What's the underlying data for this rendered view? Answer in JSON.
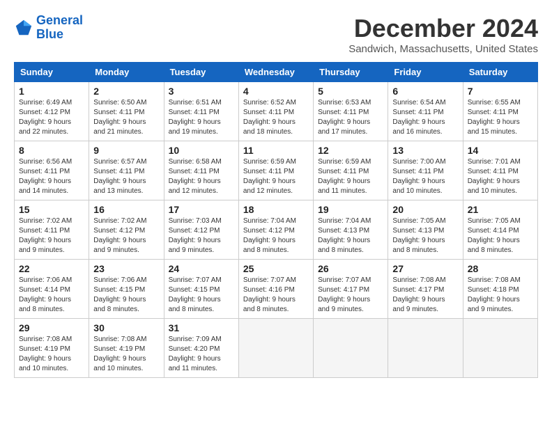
{
  "header": {
    "logo_line1": "General",
    "logo_line2": "Blue",
    "month_title": "December 2024",
    "location": "Sandwich, Massachusetts, United States"
  },
  "weekdays": [
    "Sunday",
    "Monday",
    "Tuesday",
    "Wednesday",
    "Thursday",
    "Friday",
    "Saturday"
  ],
  "weeks": [
    [
      {
        "day": "1",
        "info": "Sunrise: 6:49 AM\nSunset: 4:12 PM\nDaylight: 9 hours\nand 22 minutes."
      },
      {
        "day": "2",
        "info": "Sunrise: 6:50 AM\nSunset: 4:11 PM\nDaylight: 9 hours\nand 21 minutes."
      },
      {
        "day": "3",
        "info": "Sunrise: 6:51 AM\nSunset: 4:11 PM\nDaylight: 9 hours\nand 19 minutes."
      },
      {
        "day": "4",
        "info": "Sunrise: 6:52 AM\nSunset: 4:11 PM\nDaylight: 9 hours\nand 18 minutes."
      },
      {
        "day": "5",
        "info": "Sunrise: 6:53 AM\nSunset: 4:11 PM\nDaylight: 9 hours\nand 17 minutes."
      },
      {
        "day": "6",
        "info": "Sunrise: 6:54 AM\nSunset: 4:11 PM\nDaylight: 9 hours\nand 16 minutes."
      },
      {
        "day": "7",
        "info": "Sunrise: 6:55 AM\nSunset: 4:11 PM\nDaylight: 9 hours\nand 15 minutes."
      }
    ],
    [
      {
        "day": "8",
        "info": "Sunrise: 6:56 AM\nSunset: 4:11 PM\nDaylight: 9 hours\nand 14 minutes."
      },
      {
        "day": "9",
        "info": "Sunrise: 6:57 AM\nSunset: 4:11 PM\nDaylight: 9 hours\nand 13 minutes."
      },
      {
        "day": "10",
        "info": "Sunrise: 6:58 AM\nSunset: 4:11 PM\nDaylight: 9 hours\nand 12 minutes."
      },
      {
        "day": "11",
        "info": "Sunrise: 6:59 AM\nSunset: 4:11 PM\nDaylight: 9 hours\nand 12 minutes."
      },
      {
        "day": "12",
        "info": "Sunrise: 6:59 AM\nSunset: 4:11 PM\nDaylight: 9 hours\nand 11 minutes."
      },
      {
        "day": "13",
        "info": "Sunrise: 7:00 AM\nSunset: 4:11 PM\nDaylight: 9 hours\nand 10 minutes."
      },
      {
        "day": "14",
        "info": "Sunrise: 7:01 AM\nSunset: 4:11 PM\nDaylight: 9 hours\nand 10 minutes."
      }
    ],
    [
      {
        "day": "15",
        "info": "Sunrise: 7:02 AM\nSunset: 4:11 PM\nDaylight: 9 hours\nand 9 minutes."
      },
      {
        "day": "16",
        "info": "Sunrise: 7:02 AM\nSunset: 4:12 PM\nDaylight: 9 hours\nand 9 minutes."
      },
      {
        "day": "17",
        "info": "Sunrise: 7:03 AM\nSunset: 4:12 PM\nDaylight: 9 hours\nand 9 minutes."
      },
      {
        "day": "18",
        "info": "Sunrise: 7:04 AM\nSunset: 4:12 PM\nDaylight: 9 hours\nand 8 minutes."
      },
      {
        "day": "19",
        "info": "Sunrise: 7:04 AM\nSunset: 4:13 PM\nDaylight: 9 hours\nand 8 minutes."
      },
      {
        "day": "20",
        "info": "Sunrise: 7:05 AM\nSunset: 4:13 PM\nDaylight: 9 hours\nand 8 minutes."
      },
      {
        "day": "21",
        "info": "Sunrise: 7:05 AM\nSunset: 4:14 PM\nDaylight: 9 hours\nand 8 minutes."
      }
    ],
    [
      {
        "day": "22",
        "info": "Sunrise: 7:06 AM\nSunset: 4:14 PM\nDaylight: 9 hours\nand 8 minutes."
      },
      {
        "day": "23",
        "info": "Sunrise: 7:06 AM\nSunset: 4:15 PM\nDaylight: 9 hours\nand 8 minutes."
      },
      {
        "day": "24",
        "info": "Sunrise: 7:07 AM\nSunset: 4:15 PM\nDaylight: 9 hours\nand 8 minutes."
      },
      {
        "day": "25",
        "info": "Sunrise: 7:07 AM\nSunset: 4:16 PM\nDaylight: 9 hours\nand 8 minutes."
      },
      {
        "day": "26",
        "info": "Sunrise: 7:07 AM\nSunset: 4:17 PM\nDaylight: 9 hours\nand 9 minutes."
      },
      {
        "day": "27",
        "info": "Sunrise: 7:08 AM\nSunset: 4:17 PM\nDaylight: 9 hours\nand 9 minutes."
      },
      {
        "day": "28",
        "info": "Sunrise: 7:08 AM\nSunset: 4:18 PM\nDaylight: 9 hours\nand 9 minutes."
      }
    ],
    [
      {
        "day": "29",
        "info": "Sunrise: 7:08 AM\nSunset: 4:19 PM\nDaylight: 9 hours\nand 10 minutes."
      },
      {
        "day": "30",
        "info": "Sunrise: 7:08 AM\nSunset: 4:19 PM\nDaylight: 9 hours\nand 10 minutes."
      },
      {
        "day": "31",
        "info": "Sunrise: 7:09 AM\nSunset: 4:20 PM\nDaylight: 9 hours\nand 11 minutes."
      },
      null,
      null,
      null,
      null
    ]
  ]
}
